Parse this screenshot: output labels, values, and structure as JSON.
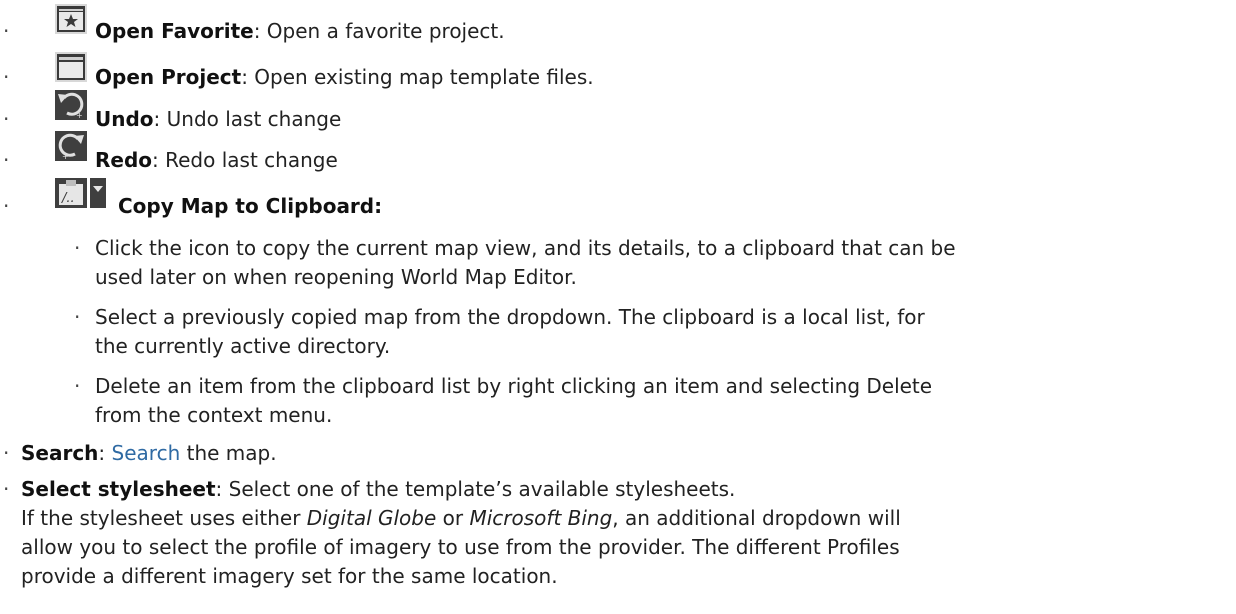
{
  "list": {
    "bullet": "·",
    "open_favorite": {
      "icon": "star-folder-icon",
      "term": "Open Favorite",
      "desc": ": Open a favorite project."
    },
    "open_project": {
      "icon": "folder-icon",
      "term": "Open Project",
      "desc": ": Open existing map template files."
    },
    "undo": {
      "icon": "undo-icon",
      "term": "Undo",
      "desc": ": Undo last change"
    },
    "redo": {
      "icon": "redo-icon",
      "term": "Redo",
      "desc": ": Redo last change"
    },
    "copy_map": {
      "icon": "clipboard-icon",
      "dropdown_icon": "dropdown-arrow-icon",
      "term": "Copy Map to Clipboard:",
      "subitems": [
        {
          "lines": [
            "Click the icon to copy the current map view, and its details, to a clipboard that can be",
            "used later on when reopening World Map Editor."
          ]
        },
        {
          "lines": [
            "Select a previously copied map from the dropdown. The clipboard is a local list, for",
            "the currently active directory."
          ]
        },
        {
          "lines": [
            "Delete an item from the clipboard list by right clicking an item and selecting Delete",
            "from the context menu."
          ]
        }
      ]
    },
    "search": {
      "term": "Search",
      "sep": ": ",
      "link": "Search",
      "desc": " the map."
    },
    "stylesheet": {
      "term": "Select stylesheet",
      "desc": ": Select one of the template’s available stylesheets.",
      "para_1": "If the stylesheet uses either ",
      "para_em1": "Digital Globe",
      "para_2": " or ",
      "para_em2": "Microsoft Bing",
      "para_3": ", an additional dropdown will",
      "para_line2": "allow you to select the profile of imagery to use from the provider. The different Profiles",
      "para_line3": "provide a different imagery set for the same location."
    }
  },
  "colors": {
    "text": "#222222",
    "link": "#2f6aa3",
    "icon_dark": "#3a3a3a",
    "icon_light": "#d8d8d8"
  }
}
